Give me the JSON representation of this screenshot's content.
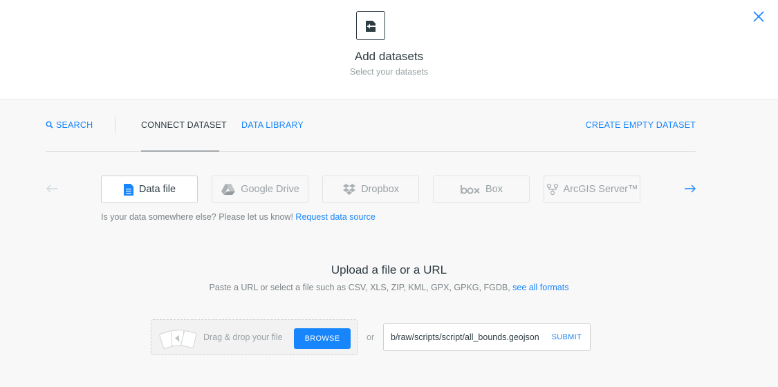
{
  "header": {
    "icon": "dataset-import-icon",
    "title": "Add datasets",
    "subtitle": "Select your datasets",
    "close_icon": "close-icon"
  },
  "tabs": {
    "search": "SEARCH",
    "connect": "CONNECT DATASET",
    "library": "DATA LIBRARY",
    "create": "CREATE EMPTY DATASET",
    "active": "connect"
  },
  "sources": [
    {
      "label": "Data file",
      "icon": "document-icon",
      "active": true
    },
    {
      "label": "Google Drive",
      "icon": "google-drive-icon",
      "active": false
    },
    {
      "label": "Dropbox",
      "icon": "dropbox-icon",
      "active": false
    },
    {
      "label": "Box",
      "icon": "box-logo-icon",
      "active": false
    },
    {
      "label": "ArcGIS Server™",
      "icon": "arcgis-icon",
      "active": false
    }
  ],
  "request": {
    "text": "Is your data somewhere else? Please let us know!",
    "link": "Request data source"
  },
  "upload": {
    "title": "Upload a file or a URL",
    "subtitle": "Paste a URL or select a file such as CSV, XLS, ZIP, KML, GPX, GPKG, FGDB,",
    "formats_link": "see all formats",
    "drop_label": "Drag & drop your file",
    "browse": "BROWSE",
    "or": "or",
    "url_value": "b/raw/scripts/script/all_bounds.geojson",
    "submit": "SUBMIT"
  },
  "colors": {
    "accent": "#1785fb",
    "text_dark": "#2e3c43",
    "text_muted": "#9aa2a6",
    "panel_bg": "#f8f8f8"
  }
}
